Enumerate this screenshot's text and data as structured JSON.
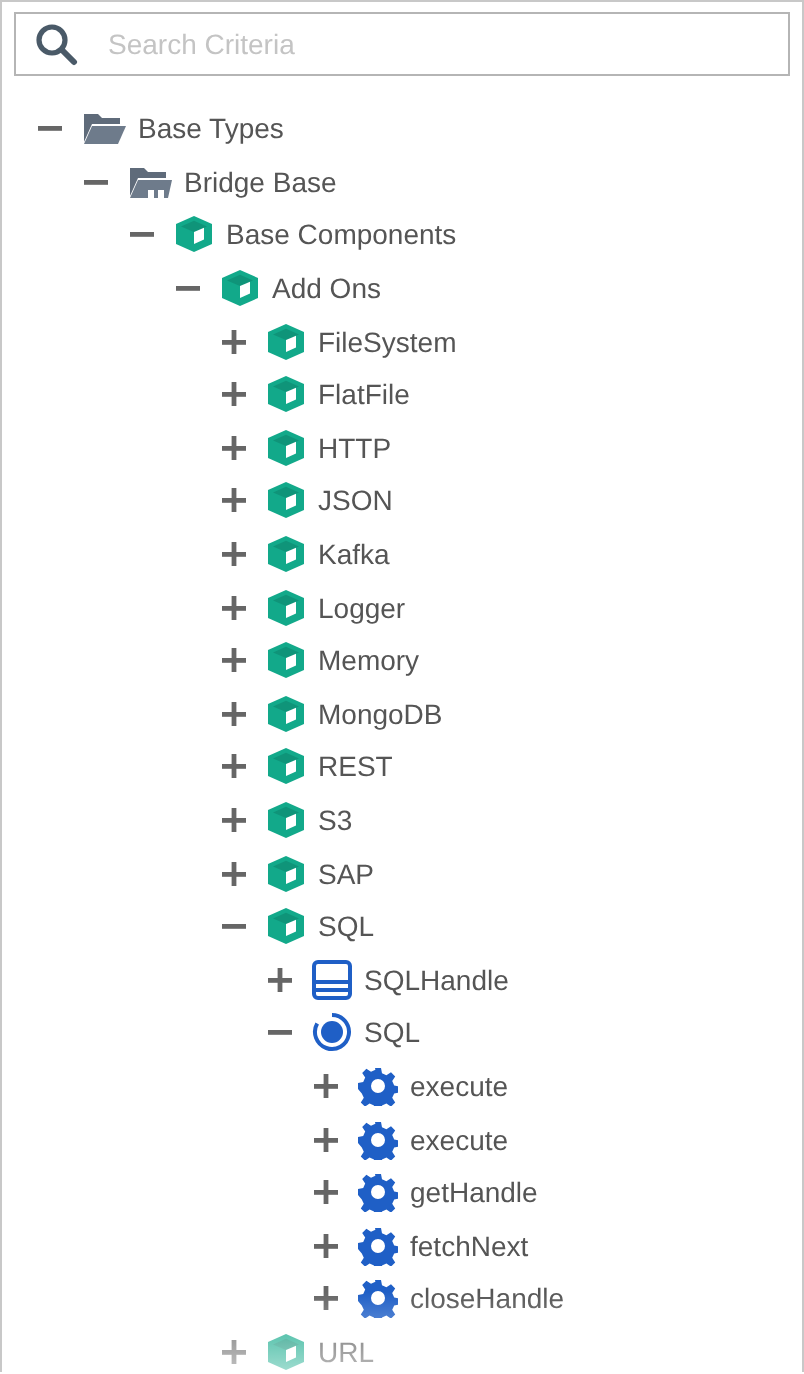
{
  "search": {
    "placeholder": "Search Criteria"
  },
  "tree": [
    {
      "label": "Base Types",
      "kind": "folder",
      "expanded": true,
      "children": [
        {
          "label": "Bridge Base",
          "kind": "bridge",
          "expanded": true,
          "children": [
            {
              "label": "Base Components",
              "kind": "cube",
              "expanded": true,
              "children": [
                {
                  "label": "Add Ons",
                  "kind": "cube",
                  "expanded": true,
                  "children": [
                    {
                      "label": "FileSystem",
                      "kind": "cube",
                      "expanded": false
                    },
                    {
                      "label": "FlatFile",
                      "kind": "cube",
                      "expanded": false
                    },
                    {
                      "label": "HTTP",
                      "kind": "cube",
                      "expanded": false
                    },
                    {
                      "label": "JSON",
                      "kind": "cube",
                      "expanded": false
                    },
                    {
                      "label": "Kafka",
                      "kind": "cube",
                      "expanded": false
                    },
                    {
                      "label": "Logger",
                      "kind": "cube",
                      "expanded": false
                    },
                    {
                      "label": "Memory",
                      "kind": "cube",
                      "expanded": false
                    },
                    {
                      "label": "MongoDB",
                      "kind": "cube",
                      "expanded": false
                    },
                    {
                      "label": "REST",
                      "kind": "cube",
                      "expanded": false
                    },
                    {
                      "label": "S3",
                      "kind": "cube",
                      "expanded": false
                    },
                    {
                      "label": "SAP",
                      "kind": "cube",
                      "expanded": false
                    },
                    {
                      "label": "SQL",
                      "kind": "cube",
                      "expanded": true,
                      "children": [
                        {
                          "label": "SQLHandle",
                          "kind": "table",
                          "expanded": false
                        },
                        {
                          "label": "SQL",
                          "kind": "circle",
                          "expanded": true,
                          "children": [
                            {
                              "label": "execute",
                              "kind": "gear",
                              "expanded": false
                            },
                            {
                              "label": "execute",
                              "kind": "gear",
                              "expanded": false
                            },
                            {
                              "label": "getHandle",
                              "kind": "gear",
                              "expanded": false
                            },
                            {
                              "label": "fetchNext",
                              "kind": "gear",
                              "expanded": false
                            },
                            {
                              "label": "closeHandle",
                              "kind": "gear",
                              "expanded": false
                            }
                          ]
                        }
                      ]
                    },
                    {
                      "label": "URL",
                      "kind": "cube",
                      "expanded": false
                    }
                  ]
                }
              ]
            }
          ]
        }
      ]
    }
  ]
}
